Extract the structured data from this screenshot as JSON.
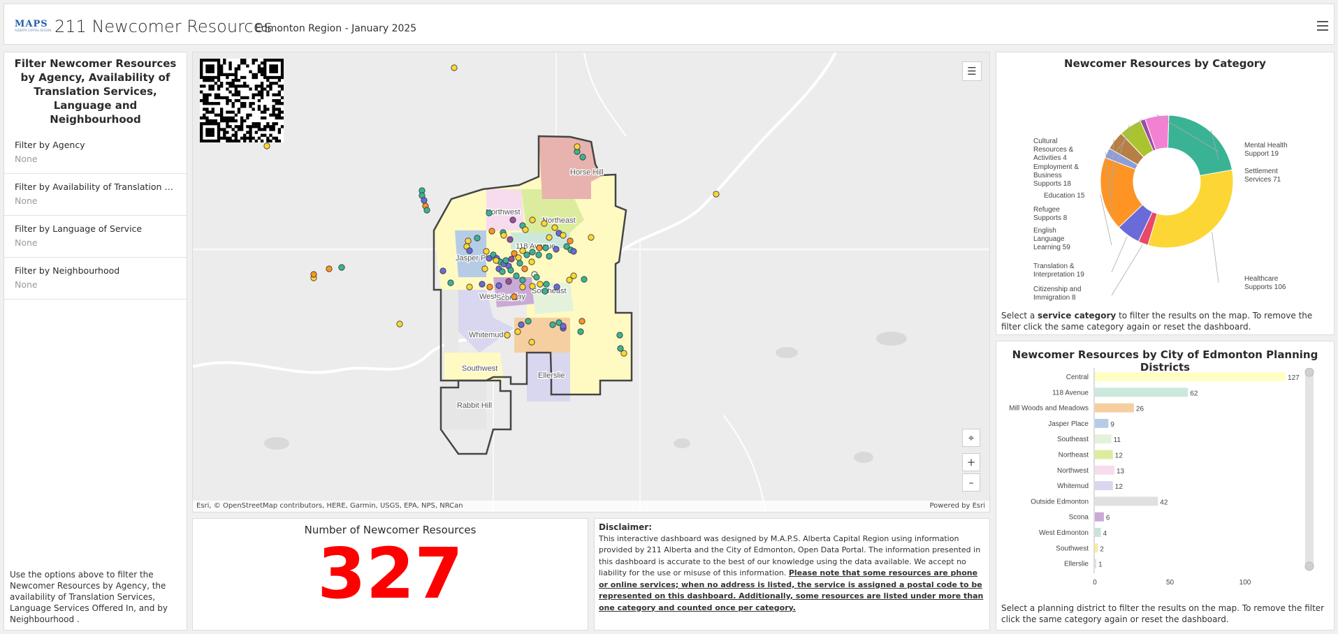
{
  "header": {
    "logo_text": "MAPS",
    "logo_tagline": "ALBERTA CAPITAL REGION",
    "title": "211 Newcomer Resources",
    "subtitle": "Edmonton Region - January 2025",
    "menu_icon": "hamburger-menu-icon"
  },
  "filters": {
    "title": "Filter Newcomer Resources by Agency, Availability of Translation Services, Language and Neighbourhood",
    "items": [
      {
        "label": "Filter by Agency",
        "value": "None"
      },
      {
        "label": "Filter by Availability of Translation Ser...",
        "value": "None"
      },
      {
        "label": "Filter by Language of Service",
        "value": "None"
      },
      {
        "label": "Filter by Neighbourhood",
        "value": "None"
      }
    ],
    "help": "Use the options above to filter the Newcomer Resources by Agency, the availability of Translation Services, Language Services Offered In, and by Neighbourhood ."
  },
  "map": {
    "district_labels": [
      "Horse Hill",
      "Northwest",
      "Northeast",
      "118 Avenue",
      "Jasper Place",
      "Southeast",
      "West Henday",
      "Scona",
      "Whitemud",
      "Southwest",
      "Ellerslie",
      "Rabbit Hill"
    ],
    "attribution": "Esri, © OpenStreetMap contributors, HERE, Garmin, USGS, EPA, NPS, NRCan",
    "powered_by": "Powered by Esri",
    "buttons": {
      "legend": "legend-list-icon",
      "locate": "locate-icon",
      "zoom_in": "+",
      "zoom_out": "–"
    }
  },
  "count": {
    "title": "Number of Newcomer Resources",
    "value": "327"
  },
  "disclaimer": {
    "heading": "Disclaimer:",
    "body": "This interactive dashboard was designed by M.A.P.S. Alberta Capital Region using information provided by 211 Alberta and the City of Edmonton, Open Data Portal. The information presented in this dashboard is accurate to the best of our knowledge using the data available. We accept no liability for the use or misuse of this information.",
    "emphasis": "Please note that some resources are phone or online services; when no address is listed, the service is assigned a postal code to be represented on this dashboard. Additionally, some resources are listed under more than one category and counted once per category."
  },
  "category_chart": {
    "title": "Newcomer Resources by Category",
    "help_prefix": "Select a ",
    "help_bold": "service category",
    "help_suffix": " to filter the results on the map. To remove the filter click the same category again or reset the dashboard."
  },
  "district_chart": {
    "title": "Newcomer Resources by City of Edmonton Planning Districts",
    "help": "Select a planning district to filter the results on the map. To remove the filter click the same category again or reset the dashboard."
  },
  "chart_data": [
    {
      "type": "pie",
      "title": "Newcomer Resources by Category",
      "categories": [
        "Settlement Services",
        "Healthcare Supports",
        "Citizenship and Immigration",
        "Translation & Interpretation",
        "English Language Learning",
        "Refugee Supports",
        "Education",
        "Employment & Business Supports",
        "Cultural Resources & Activities",
        "Mental Health Support"
      ],
      "values": [
        71,
        106,
        8,
        19,
        59,
        8,
        15,
        18,
        4,
        19
      ],
      "colors": [
        "#3ab395",
        "#fcd634",
        "#e8486a",
        "#6a6ad8",
        "#fd9424",
        "#8d9dd8",
        "#b77f46",
        "#a9c42e",
        "#9a4fa0",
        "#f381d3"
      ]
    },
    {
      "type": "bar",
      "orientation": "horizontal",
      "title": "Newcomer Resources by City of Edmonton Planning Districts",
      "categories": [
        "Central",
        "118 Avenue",
        "Mill Woods and Meadows",
        "Jasper Place",
        "Southeast",
        "Northeast",
        "Northwest",
        "Whitemud",
        "Outside Edmonton",
        "Scona",
        "West Edmonton",
        "Southwest",
        "Ellerslie"
      ],
      "values": [
        127,
        62,
        26,
        9,
        11,
        12,
        13,
        12,
        42,
        6,
        4,
        2,
        1
      ],
      "colors": [
        "#ffffc4",
        "#cce8dc",
        "#f5cfa0",
        "#b6cce6",
        "#e4f2dc",
        "#dcec9e",
        "#f6dced",
        "#d9d7ef",
        "#e0e0e0",
        "#c9a9d6",
        "#c9e3dc",
        "#fde9a0",
        "#e0e0e0"
      ],
      "xlim": [
        0,
        135
      ],
      "xticks": [
        0,
        50,
        100
      ]
    }
  ]
}
